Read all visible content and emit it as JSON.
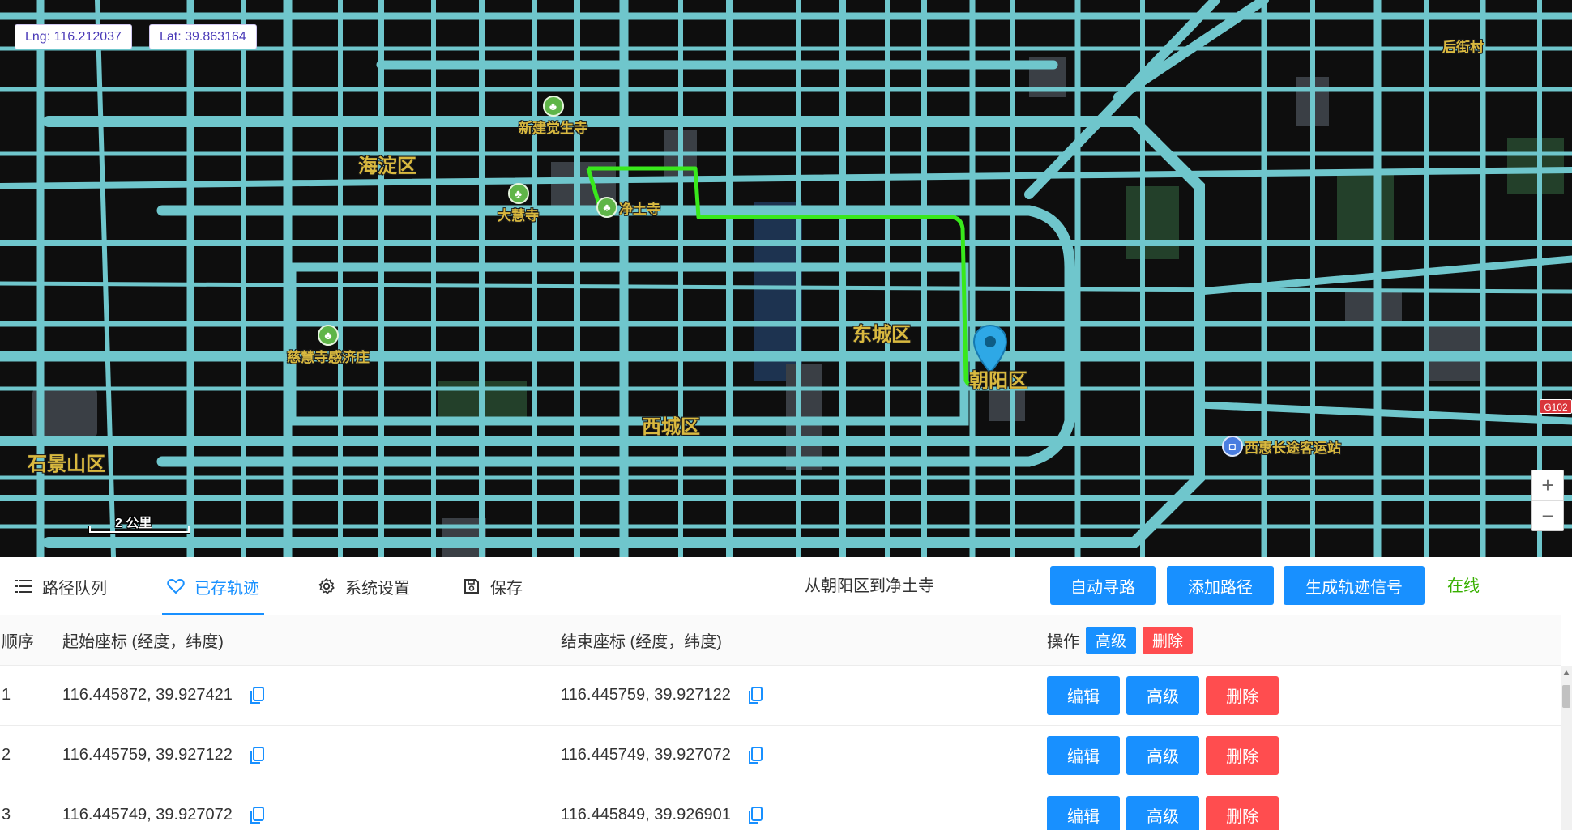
{
  "map": {
    "lng_label": "Lng: 116.212037",
    "lat_label": "Lat: 39.863164",
    "districts": [
      {
        "name": "海淀区"
      },
      {
        "name": "东城区"
      },
      {
        "name": "西城区"
      },
      {
        "name": "朝阳区"
      },
      {
        "name": "石景山区"
      },
      {
        "name": "后街村"
      }
    ],
    "pois": [
      {
        "name": "新建觉生寺",
        "icon": "park-icon"
      },
      {
        "name": "大慧寺",
        "icon": "park-icon"
      },
      {
        "name": "净土寺",
        "icon": "park-icon"
      },
      {
        "name": "慈慧寺感济庄",
        "icon": "park-icon"
      },
      {
        "name": "西惠长途客运站",
        "icon": "bus-station-icon"
      }
    ],
    "road_tag": "G102",
    "scale_label": "2 公里",
    "zoom_in": "+",
    "zoom_out": "−",
    "route_color": "#39e81c",
    "road_color": "#6fc6cc",
    "marker_color": "#2ea8e6"
  },
  "toolbar": {
    "tabs": [
      {
        "label": "路径队列",
        "icon": "list-icon"
      },
      {
        "label": "已存轨迹",
        "icon": "heart-icon",
        "active": true
      },
      {
        "label": "系统设置",
        "icon": "gear-icon"
      },
      {
        "label": "保存",
        "icon": "save-icon"
      }
    ],
    "route_title": "从朝阳区到净土寺",
    "auto_route": "自动寻路",
    "add_path": "添加路径",
    "generate_signal": "生成轨迹信号",
    "status": "在线",
    "accent_color": "#1890ff",
    "status_color": "#38b000"
  },
  "table": {
    "headers": {
      "index": "顺序",
      "start": "起始座标 (经度，纬度)",
      "end": "结束座标 (经度，纬度)",
      "ops": "操作",
      "advanced": "高级",
      "delete": "删除"
    },
    "rows": [
      {
        "index": "1",
        "start": "116.445872, 39.927421",
        "end": "116.445759, 39.927122"
      },
      {
        "index": "2",
        "start": "116.445759, 39.927122",
        "end": "116.445749, 39.927072"
      },
      {
        "index": "3",
        "start": "116.445749, 39.927072",
        "end": "116.445849, 39.926901"
      }
    ],
    "row_actions": {
      "edit": "编辑",
      "advanced": "高级",
      "delete": "删除"
    }
  }
}
